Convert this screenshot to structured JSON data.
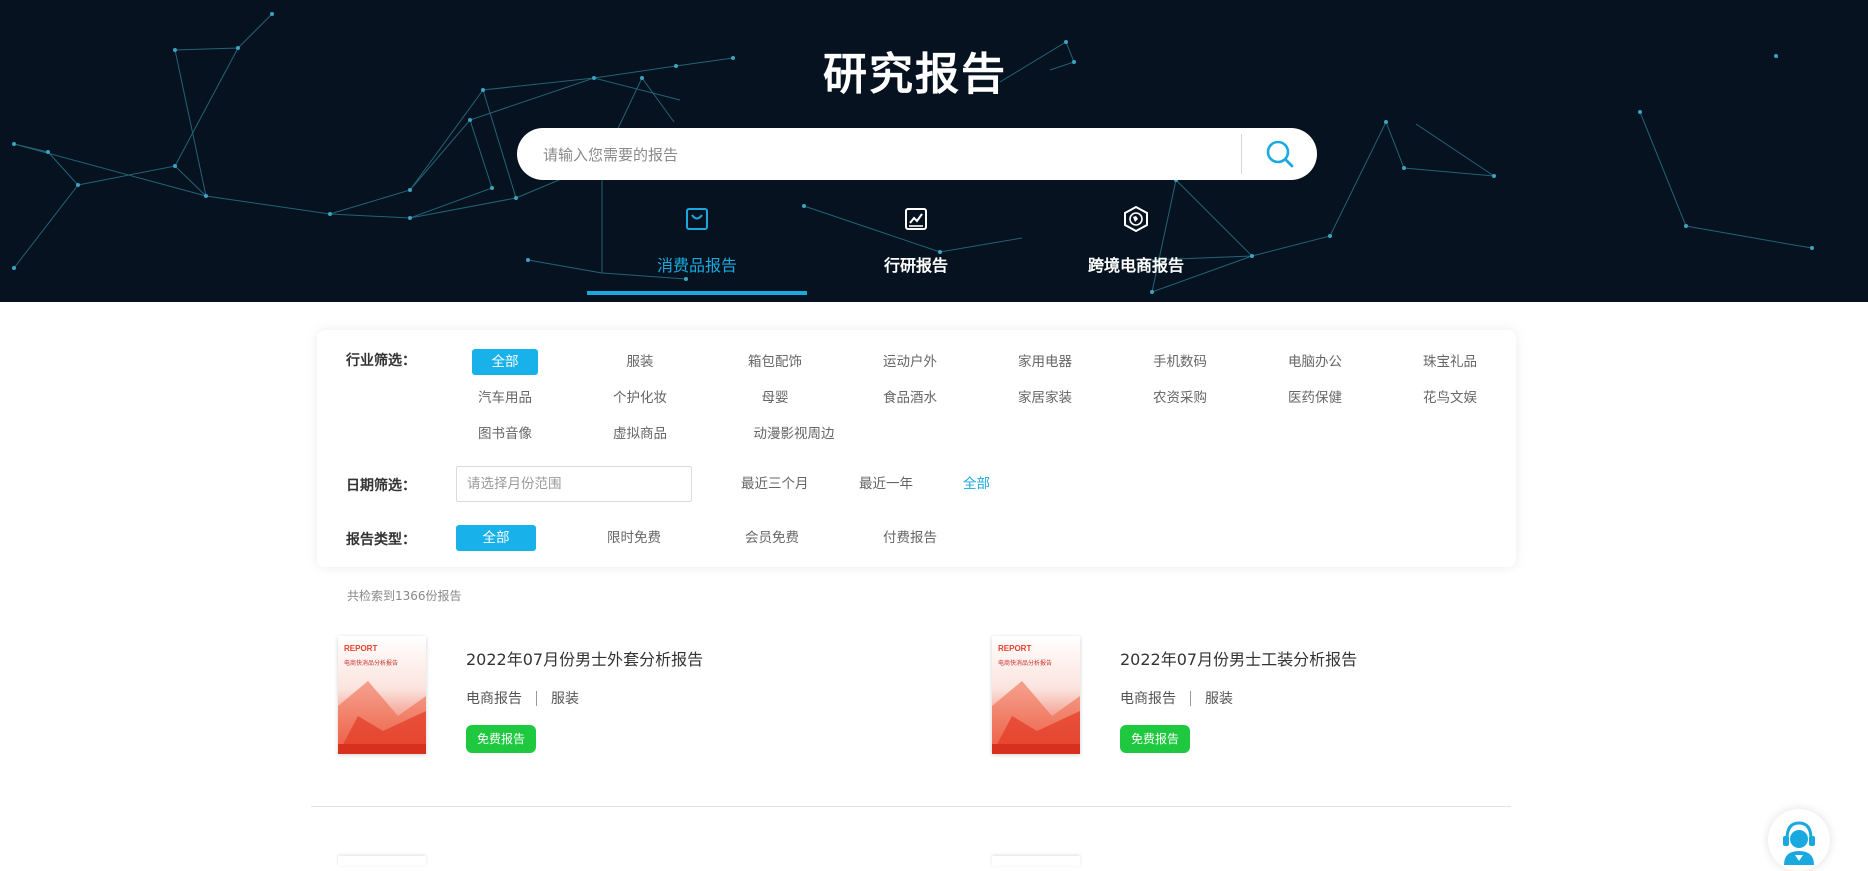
{
  "hero": {
    "title": "研究报告",
    "search": {
      "placeholder": "请输入您需要的报告",
      "button_icon": "search-icon"
    },
    "tabs": [
      {
        "label": "消费品报告",
        "icon": "shopping-bag-icon",
        "active": true
      },
      {
        "label": "行研报告",
        "icon": "line-chart-icon",
        "active": false
      },
      {
        "label": "跨境电商报告",
        "icon": "globe-shield-icon",
        "active": false
      }
    ]
  },
  "filters": {
    "industry": {
      "label": "行业筛选：",
      "options": [
        "全部",
        "服装",
        "箱包配饰",
        "运动户外",
        "家用电器",
        "手机数码",
        "电脑办公",
        "珠宝礼品",
        "汽车用品",
        "个护化妆",
        "母婴",
        "食品酒水",
        "家居家装",
        "农资采购",
        "医药保健",
        "花鸟文娱",
        "图书音像",
        "虚拟商品",
        "动漫影视周边"
      ],
      "selected": "全部"
    },
    "date": {
      "label": "日期筛选：",
      "placeholder": "请选择月份范围",
      "options": [
        "最近三个月",
        "最近一年",
        "全部"
      ],
      "selected": "全部"
    },
    "type": {
      "label": "报告类型：",
      "options": [
        "全部",
        "限时免费",
        "会员免费",
        "付费报告"
      ],
      "selected": "全部"
    }
  },
  "results": {
    "count_text": "共检索到1366份报告"
  },
  "reports": [
    {
      "title": "2022年07月份男士外套分析报告",
      "category": "电商报告",
      "industry": "服装",
      "badge": "免费报告",
      "cover": {
        "tag": "REPORT",
        "subtitle": "电商快消品分析报告"
      }
    },
    {
      "title": "2022年07月份男士工装分析报告",
      "category": "电商报告",
      "industry": "服装",
      "badge": "免费报告",
      "cover": {
        "tag": "REPORT",
        "subtitle": "电商快消品分析报告"
      }
    }
  ],
  "colors": {
    "hero_bg": "#06121f",
    "accent": "#19a9de",
    "chip_active": "#19b1ea",
    "free_badge": "#1ec93f"
  },
  "service": {
    "icon": "customer-service-icon"
  }
}
